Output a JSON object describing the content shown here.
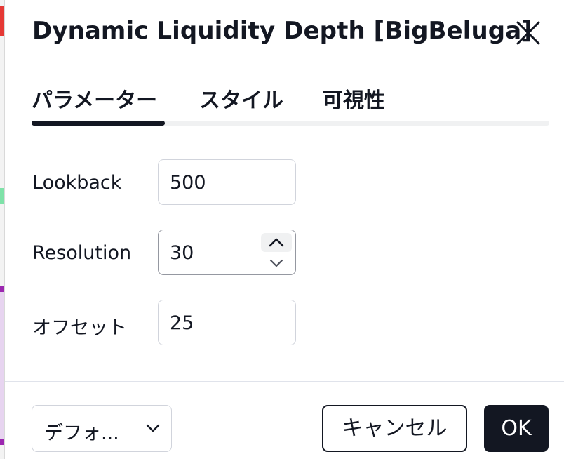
{
  "dialog": {
    "title": "Dynamic Liquidity Depth [BigBeluga]"
  },
  "tabs": [
    {
      "label": "パラメーター",
      "active": true
    },
    {
      "label": "スタイル",
      "active": false
    },
    {
      "label": "可視性",
      "active": false
    }
  ],
  "params": {
    "lookback": {
      "label": "Lookback",
      "value": "500"
    },
    "resolution": {
      "label": "Resolution",
      "value": "30"
    },
    "offset": {
      "label": "オフセット",
      "value": "25"
    }
  },
  "footer": {
    "defaults_label": "デフォ...",
    "cancel_label": "キャンセル",
    "ok_label": "OK"
  },
  "icons": {
    "close": "close-icon",
    "stepper_up": "chevron-up-icon",
    "stepper_down": "chevron-down-icon",
    "defaults_chevron": "chevron-down-icon"
  },
  "colors": {
    "text": "#131722",
    "primary_button": "#131722",
    "border": "#d1d4dc"
  }
}
